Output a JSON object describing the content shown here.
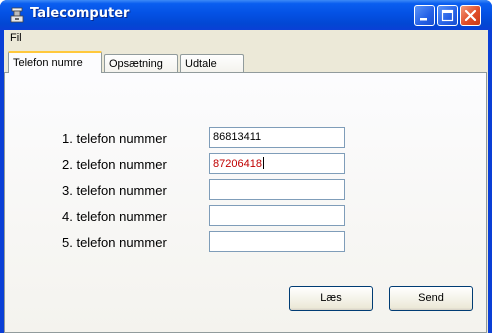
{
  "window": {
    "title": "Talecomputer"
  },
  "menu": {
    "items": [
      "Fil"
    ]
  },
  "tabs": [
    "Telefon numre",
    "Opsætning",
    "Udtale"
  ],
  "phones": [
    {
      "label": "1. telefon nummer",
      "value": "86813411"
    },
    {
      "label": "2. telefon nummer",
      "value": "87206418"
    },
    {
      "label": "3. telefon nummer",
      "value": ""
    },
    {
      "label": "4. telefon nummer",
      "value": ""
    },
    {
      "label": "5. telefon nummer",
      "value": ""
    }
  ],
  "buttons": {
    "read": "Læs",
    "send": "Send"
  },
  "colors": {
    "titlebar": "#0451e4",
    "face": "#ece9d8",
    "active_tab_highlight": "#ffc83c",
    "second_number_text": "#c00000"
  }
}
